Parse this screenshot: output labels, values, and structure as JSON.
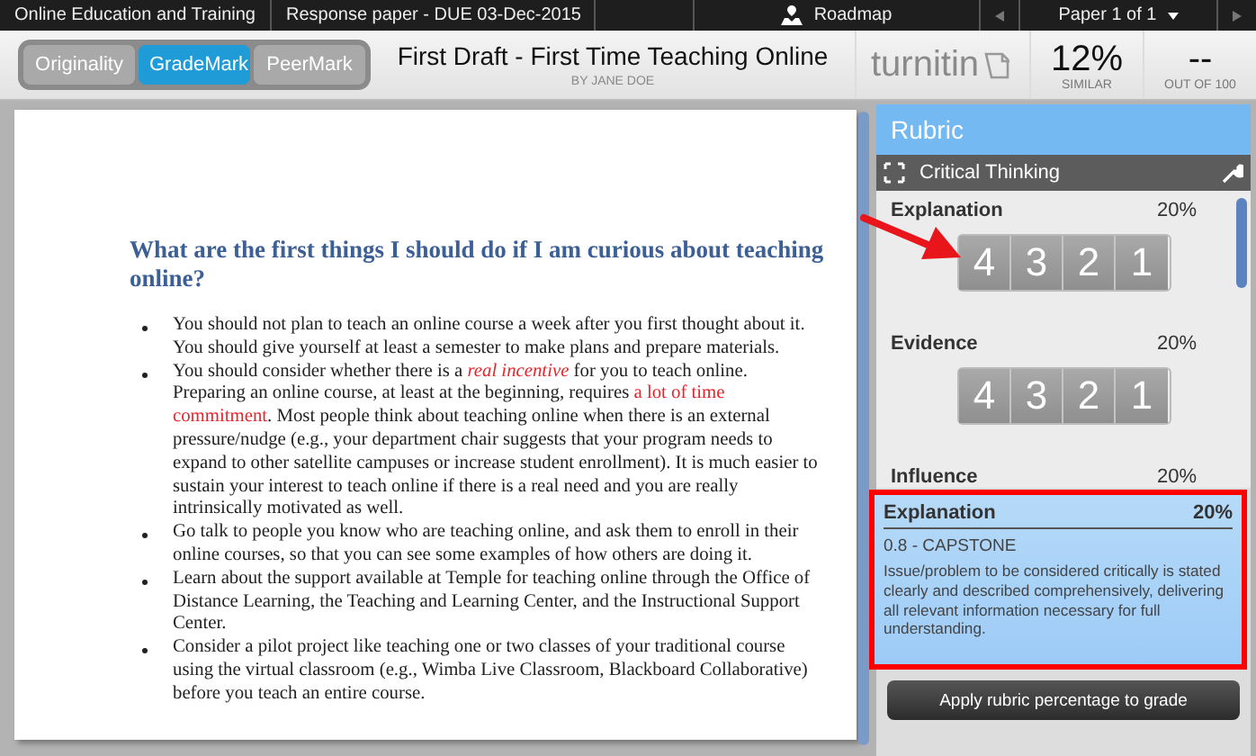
{
  "top_bar": {
    "class_name": "Online Education and Training",
    "assignment": "Response paper - DUE 03-Dec-2015",
    "roadmap": "Roadmap",
    "paper": "Paper 1 of 1"
  },
  "tabs": [
    {
      "label": "Originality",
      "selected": false
    },
    {
      "label": "GradeMark",
      "selected": true
    },
    {
      "label": "PeerMark",
      "selected": false
    }
  ],
  "paper": {
    "title": "First Draft - First Time Teaching Online",
    "author": "BY JANE DOE"
  },
  "logo": "turnitin",
  "similarity": {
    "value": "12%",
    "label": "SIMILAR"
  },
  "grade": {
    "value": "--",
    "label": "OUT OF 100"
  },
  "document": {
    "heading": "What are the first things I should do if I am curious about teaching online?",
    "bullets": [
      [
        {
          "text": "You should not plan to teach an online course a week after you first thought about it. You should give yourself at least a semester to make plans and prepare materials.",
          "highlight": false
        }
      ],
      [
        {
          "text": "You should consider whether there is a ",
          "highlight": false
        },
        {
          "text": "real incentive",
          "highlight": true,
          "italic": true
        },
        {
          "text": " for you to teach online. Preparing an online course, at least at the beginning, requires ",
          "highlight": false
        },
        {
          "text": "a lot of time commitment",
          "highlight": true
        },
        {
          "text": ". Most people think about teaching online when there is an external pressure/nudge (e.g., your department chair suggests that your program needs to expand to other satellite campuses or increase student enrollment). It is much easier to sustain your interest to teach online if there is a real need and you are really intrinsically motivated as well.",
          "highlight": false
        }
      ],
      [
        {
          "text": "Go talk to people you know who are teaching online, and ask them to enroll in their online courses, so that you can see some examples of how others are doing it.",
          "highlight": false
        }
      ],
      [
        {
          "text": "Learn about the support available at Temple for teaching online through the Office of Distance Learning, the Teaching and Learning Center, and the Instructional Support Center.",
          "highlight": false
        }
      ],
      [
        {
          "text": "Consider a pilot project like teaching one or two classes of your traditional course using the virtual classroom (e.g., Wimba Live Classroom, Blackboard Collaborative) before you teach an entire course.",
          "highlight": false
        }
      ]
    ]
  },
  "rubric": {
    "title": "Rubric",
    "name": "Critical Thinking",
    "criteria": [
      {
        "name": "Explanation",
        "percent": "20%",
        "scores": [
          "4",
          "3",
          "2",
          "1"
        ]
      },
      {
        "name": "Evidence",
        "percent": "20%",
        "scores": [
          "4",
          "3",
          "2",
          "1"
        ]
      },
      {
        "name": "Influence",
        "percent": "20%"
      }
    ],
    "detail": {
      "name": "Explanation",
      "percent": "20%",
      "level": "0.8 - CAPSTONE",
      "description": "Issue/problem to be considered critically is stated clearly and described comprehensively, delivering all relevant information necessary for full understanding."
    },
    "apply_button": "Apply rubric percentage to grade"
  }
}
